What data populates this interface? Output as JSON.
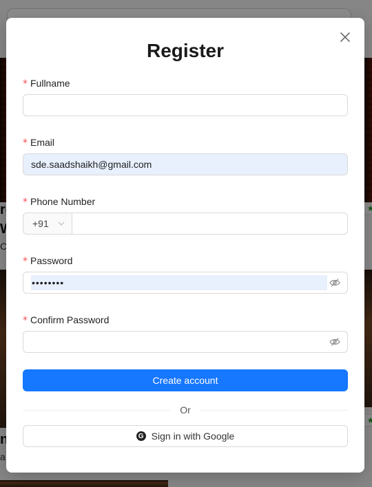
{
  "modal": {
    "title": "Register",
    "fields": {
      "fullname": {
        "label": "Fullname",
        "required_mark": "*",
        "value": ""
      },
      "email": {
        "label": "Email",
        "required_mark": "*",
        "value": "sde.saadshaikh@gmail.com"
      },
      "phone": {
        "label": "Phone Number",
        "required_mark": "*",
        "country_code": "+91",
        "value": ""
      },
      "password": {
        "label": "Password",
        "required_mark": "*",
        "value": "••••••••"
      },
      "confirm_password": {
        "label": "Confirm Password",
        "required_mark": "*",
        "value": ""
      }
    },
    "create_button": "Create account",
    "divider_text": "Or",
    "google_button": "Sign in with Google",
    "google_icon_letter": "G"
  },
  "icons": {
    "close": "close-icon",
    "eye_off": "eye-slash-icon",
    "chevron": "chevron-down-icon",
    "google": "google-icon"
  },
  "background": {
    "fragments": [
      "re",
      "W",
      "C",
      "n",
      "a"
    ]
  },
  "colors": {
    "primary": "#1677ff",
    "required": "#ff4d4f",
    "autofill": "#e8f0fe",
    "overlay": "rgba(0,0,0,0.45)",
    "rating_star": "#2e9a2e"
  }
}
